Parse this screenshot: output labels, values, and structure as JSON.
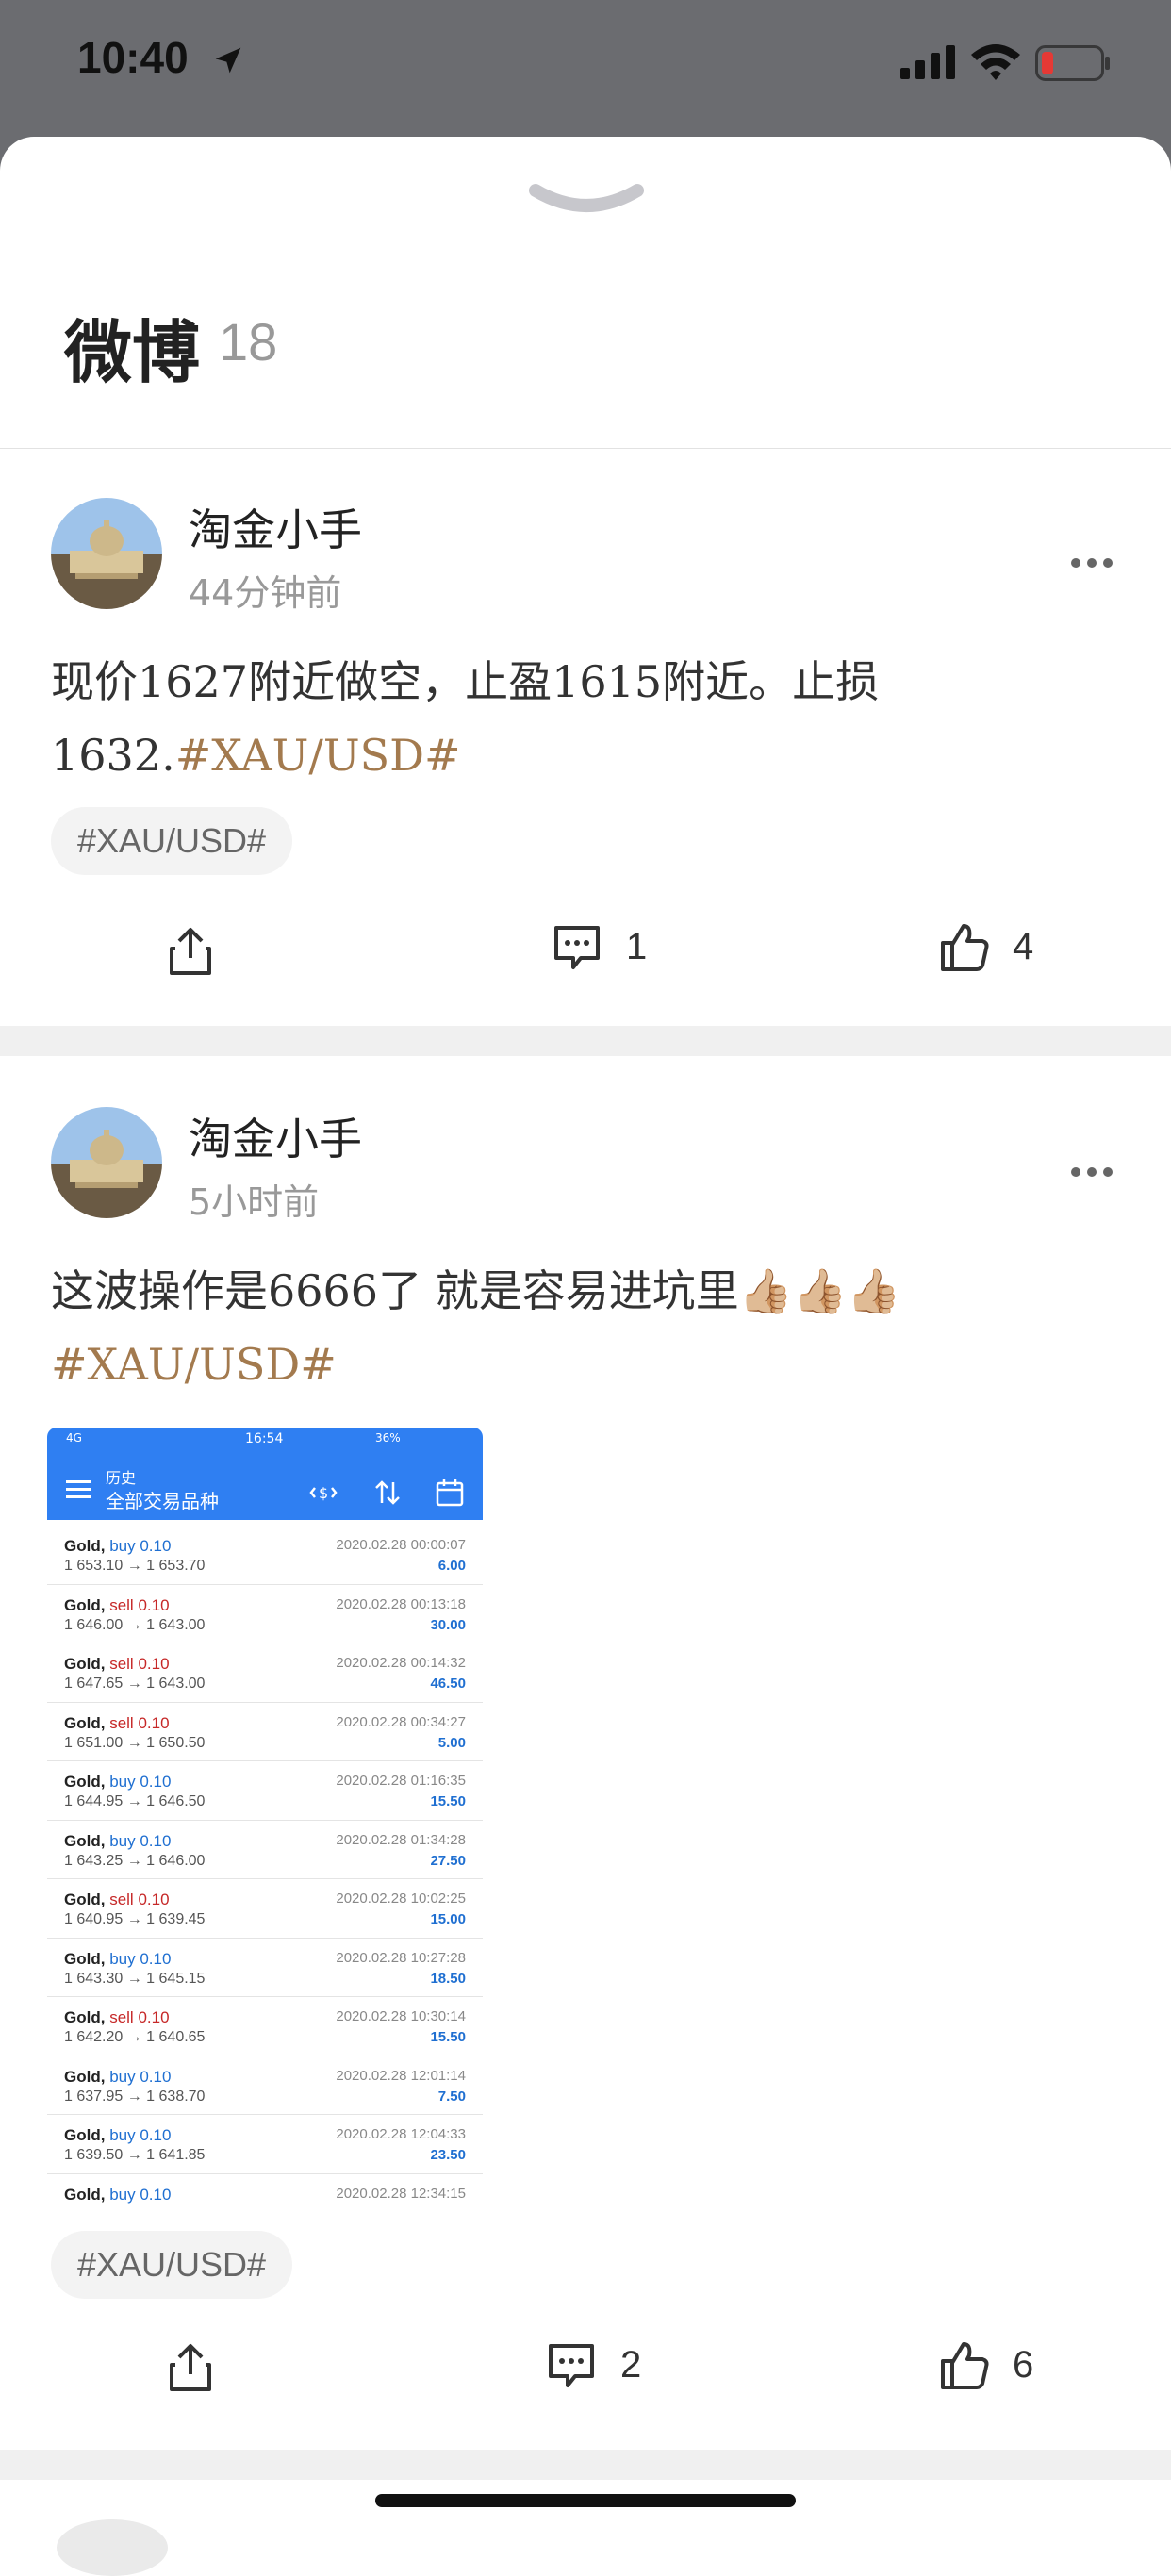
{
  "status_bar": {
    "time": "10:40"
  },
  "sheet": {
    "title": "微博",
    "count": "18"
  },
  "posts": [
    {
      "author": "淘金小手",
      "time": "44分钟前",
      "text": "现价1627附近做空，止盈1615附近。止损1632.",
      "text_hashtag": "#XAU/USD#",
      "tag": "#XAU/USD#",
      "comments": "1",
      "likes": "4"
    },
    {
      "author": "淘金小手",
      "time": "5小时前",
      "text": "这波操作是6666了 就是容易进坑里👍🏼👍🏼👍🏼",
      "text_hashtag": "#XAU/USD#",
      "tag": "#XAU/USD#",
      "comments": "2",
      "likes": "6",
      "screenshot": {
        "status_time": "16:54",
        "status_left": "4G",
        "status_right": "36%",
        "header_small": "历史",
        "header_title": "全部交易品种",
        "trades": [
          {
            "symbol": "Gold,",
            "side": "buy",
            "lot": "0.10",
            "prices": "1 653.10 → 1 653.70",
            "date": "2020.02.28 00:00:07",
            "profit": "6.00"
          },
          {
            "symbol": "Gold,",
            "side": "sell",
            "lot": "0.10",
            "prices": "1 646.00 → 1 643.00",
            "date": "2020.02.28 00:13:18",
            "profit": "30.00"
          },
          {
            "symbol": "Gold,",
            "side": "sell",
            "lot": "0.10",
            "prices": "1 647.65 → 1 643.00",
            "date": "2020.02.28 00:14:32",
            "profit": "46.50"
          },
          {
            "symbol": "Gold,",
            "side": "sell",
            "lot": "0.10",
            "prices": "1 651.00 → 1 650.50",
            "date": "2020.02.28 00:34:27",
            "profit": "5.00"
          },
          {
            "symbol": "Gold,",
            "side": "buy",
            "lot": "0.10",
            "prices": "1 644.95 → 1 646.50",
            "date": "2020.02.28 01:16:35",
            "profit": "15.50"
          },
          {
            "symbol": "Gold,",
            "side": "buy",
            "lot": "0.10",
            "prices": "1 643.25 → 1 646.00",
            "date": "2020.02.28 01:34:28",
            "profit": "27.50"
          },
          {
            "symbol": "Gold,",
            "side": "sell",
            "lot": "0.10",
            "prices": "1 640.95 → 1 639.45",
            "date": "2020.02.28 10:02:25",
            "profit": "15.00"
          },
          {
            "symbol": "Gold,",
            "side": "buy",
            "lot": "0.10",
            "prices": "1 643.30 → 1 645.15",
            "date": "2020.02.28 10:27:28",
            "profit": "18.50"
          },
          {
            "symbol": "Gold,",
            "side": "sell",
            "lot": "0.10",
            "prices": "1 642.20 → 1 640.65",
            "date": "2020.02.28 10:30:14",
            "profit": "15.50"
          },
          {
            "symbol": "Gold,",
            "side": "buy",
            "lot": "0.10",
            "prices": "1 637.95 → 1 638.70",
            "date": "2020.02.28 12:01:14",
            "profit": "7.50"
          },
          {
            "symbol": "Gold,",
            "side": "buy",
            "lot": "0.10",
            "prices": "1 639.50 → 1 641.85",
            "date": "2020.02.28 12:04:33",
            "profit": "23.50"
          },
          {
            "symbol": "Gold,",
            "side": "buy",
            "lot": "0.10",
            "prices": "",
            "date": "2020.02.28 12:34:15",
            "profit": ""
          }
        ]
      }
    }
  ],
  "colors": {
    "hashtag": "#a37a4e",
    "buy": "#1f6fd1",
    "sell": "#c62828",
    "app_blue": "#2f7ff2"
  }
}
